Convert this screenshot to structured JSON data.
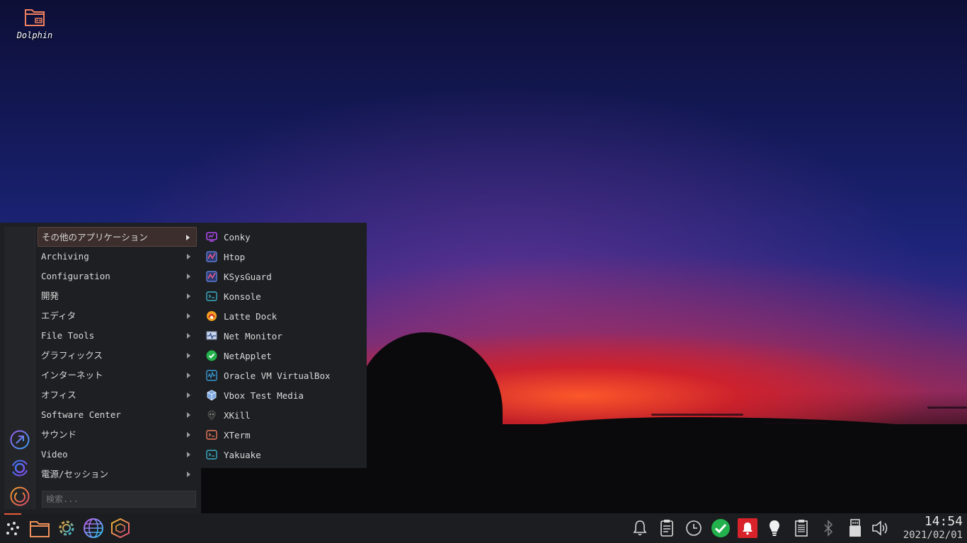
{
  "desktop": {
    "icons": [
      {
        "label": "Dolphin",
        "icon": "folder-icon"
      }
    ]
  },
  "menu": {
    "categories": [
      {
        "label": "その他のアプリケーション",
        "active": true
      },
      {
        "label": "Archiving"
      },
      {
        "label": "Configuration"
      },
      {
        "label": "開発"
      },
      {
        "label": "エディタ"
      },
      {
        "label": "File Tools"
      },
      {
        "label": "グラフィックス"
      },
      {
        "label": "インターネット"
      },
      {
        "label": "オフィス"
      },
      {
        "label": "Software Center"
      },
      {
        "label": "サウンド"
      },
      {
        "label": "Video"
      },
      {
        "label": "電源/セッション"
      }
    ],
    "search_placeholder": "検索...",
    "sidebar_buttons": [
      "arrow-out-icon",
      "refresh-icon",
      "power-icon"
    ]
  },
  "submenu": {
    "items": [
      {
        "label": "Conky",
        "icon": "conky-icon"
      },
      {
        "label": "Htop",
        "icon": "htop-icon"
      },
      {
        "label": "KSysGuard",
        "icon": "ksysguard-icon"
      },
      {
        "label": "Konsole",
        "icon": "terminal-icon"
      },
      {
        "label": "Latte Dock",
        "icon": "latte-icon"
      },
      {
        "label": "Net Monitor",
        "icon": "net-monitor-icon"
      },
      {
        "label": "NetApplet",
        "icon": "check-icon"
      },
      {
        "label": "Oracle VM VirtualBox",
        "icon": "virtualbox-icon"
      },
      {
        "label": "Vbox Test Media",
        "icon": "cube-icon"
      },
      {
        "label": "XKill",
        "icon": "skull-icon"
      },
      {
        "label": "XTerm",
        "icon": "terminal-icon"
      },
      {
        "label": "Yakuake",
        "icon": "terminal-icon"
      }
    ]
  },
  "taskbar": {
    "launchers": [
      "app-launcher-icon",
      "folder-icon",
      "settings-icon",
      "browser-icon",
      "package-icon"
    ],
    "tray": [
      "bell-icon",
      "clipboard-icon",
      "clock-icon",
      "check-icon",
      "notification-icon",
      "lightbulb-icon",
      "notes-icon",
      "bluetooth-icon",
      "usb-drive-icon",
      "volume-icon"
    ],
    "time": "14:54",
    "date": "2021/02/01"
  },
  "colors": {
    "accent": "#e85a3a",
    "panel_bg": "#1b1d20",
    "menu_bg": "#1d1f22",
    "active_category": "#3b2e2c",
    "tray_alert": "#d8232a",
    "tray_ok": "#22b14c"
  }
}
